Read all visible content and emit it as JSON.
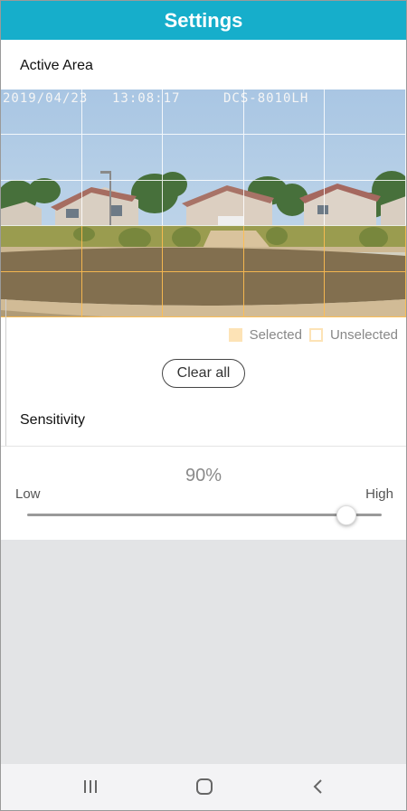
{
  "header": {
    "title": "Settings"
  },
  "active_area": {
    "title": "Active Area",
    "camera_overlay": {
      "date": "2019/04/23",
      "time": "13:08:17",
      "model": "DCS-8010LH"
    },
    "grid": {
      "rows": 5,
      "cols": 5,
      "selected": [
        [
          false,
          false,
          false,
          false,
          false
        ],
        [
          false,
          false,
          false,
          false,
          false
        ],
        [
          false,
          false,
          false,
          false,
          false
        ],
        [
          true,
          true,
          true,
          true,
          true
        ],
        [
          true,
          true,
          true,
          true,
          true
        ]
      ]
    },
    "legend": {
      "selected_label": "Selected",
      "unselected_label": "Unselected"
    },
    "clear_button": "Clear all"
  },
  "sensitivity": {
    "title": "Sensitivity",
    "value_label": "90%",
    "value": 0.9,
    "low_label": "Low",
    "high_label": "High"
  },
  "navbar": {
    "recent_icon": "recent-apps-icon",
    "home_icon": "home-icon",
    "back_icon": "back-icon"
  },
  "colors": {
    "accent": "#16aecb",
    "selected_cell": "#fde3b6"
  }
}
